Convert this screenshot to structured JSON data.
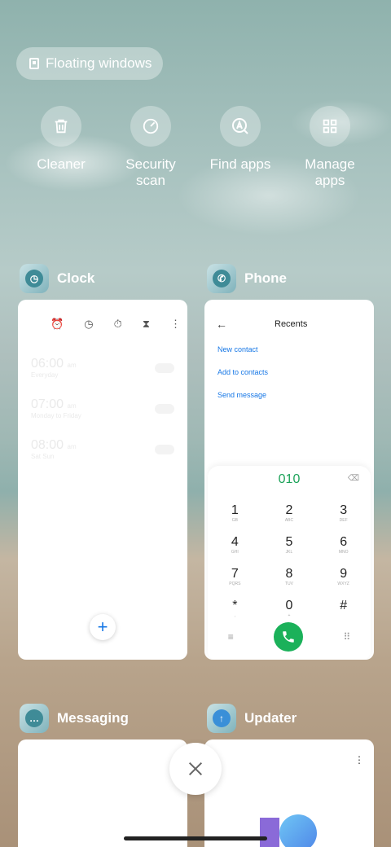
{
  "floating_windows": {
    "label": "Floating windows",
    "icon": "floating-window-icon"
  },
  "quick_actions": [
    {
      "label": "Cleaner",
      "icon": "trash-icon"
    },
    {
      "label": "Security\nscan",
      "icon": "security-scan-icon"
    },
    {
      "label": "Find apps",
      "icon": "find-apps-icon"
    },
    {
      "label": "Manage\napps",
      "icon": "manage-apps-icon"
    }
  ],
  "apps": {
    "clock": {
      "name": "Clock",
      "alarms": [
        {
          "time": "06:00",
          "suffix": "am",
          "repeat": "Everyday"
        },
        {
          "time": "07:00",
          "suffix": "am",
          "repeat": "Monday to Friday"
        },
        {
          "time": "08:00",
          "suffix": "am",
          "repeat": "Sat Sun"
        }
      ],
      "add_label": "+"
    },
    "phone": {
      "name": "Phone",
      "title": "Recents",
      "links": [
        "New contact",
        "Add to contacts",
        "Send message"
      ],
      "dialed_number": "010",
      "keys": [
        {
          "d": "1",
          "l": "GB"
        },
        {
          "d": "2",
          "l": "ABC"
        },
        {
          "d": "3",
          "l": "DEF"
        },
        {
          "d": "4",
          "l": "GHI"
        },
        {
          "d": "5",
          "l": "JKL"
        },
        {
          "d": "6",
          "l": "MNO"
        },
        {
          "d": "7",
          "l": "PQRS"
        },
        {
          "d": "8",
          "l": "TUV"
        },
        {
          "d": "9",
          "l": "WXYZ"
        },
        {
          "d": "*",
          "l": ","
        },
        {
          "d": "0",
          "l": "+"
        },
        {
          "d": "#",
          "l": ""
        }
      ]
    },
    "messaging": {
      "name": "Messaging"
    },
    "updater": {
      "name": "Updater"
    }
  },
  "colors": {
    "accent_blue": "#1677e6",
    "call_green": "#1bb15a"
  }
}
